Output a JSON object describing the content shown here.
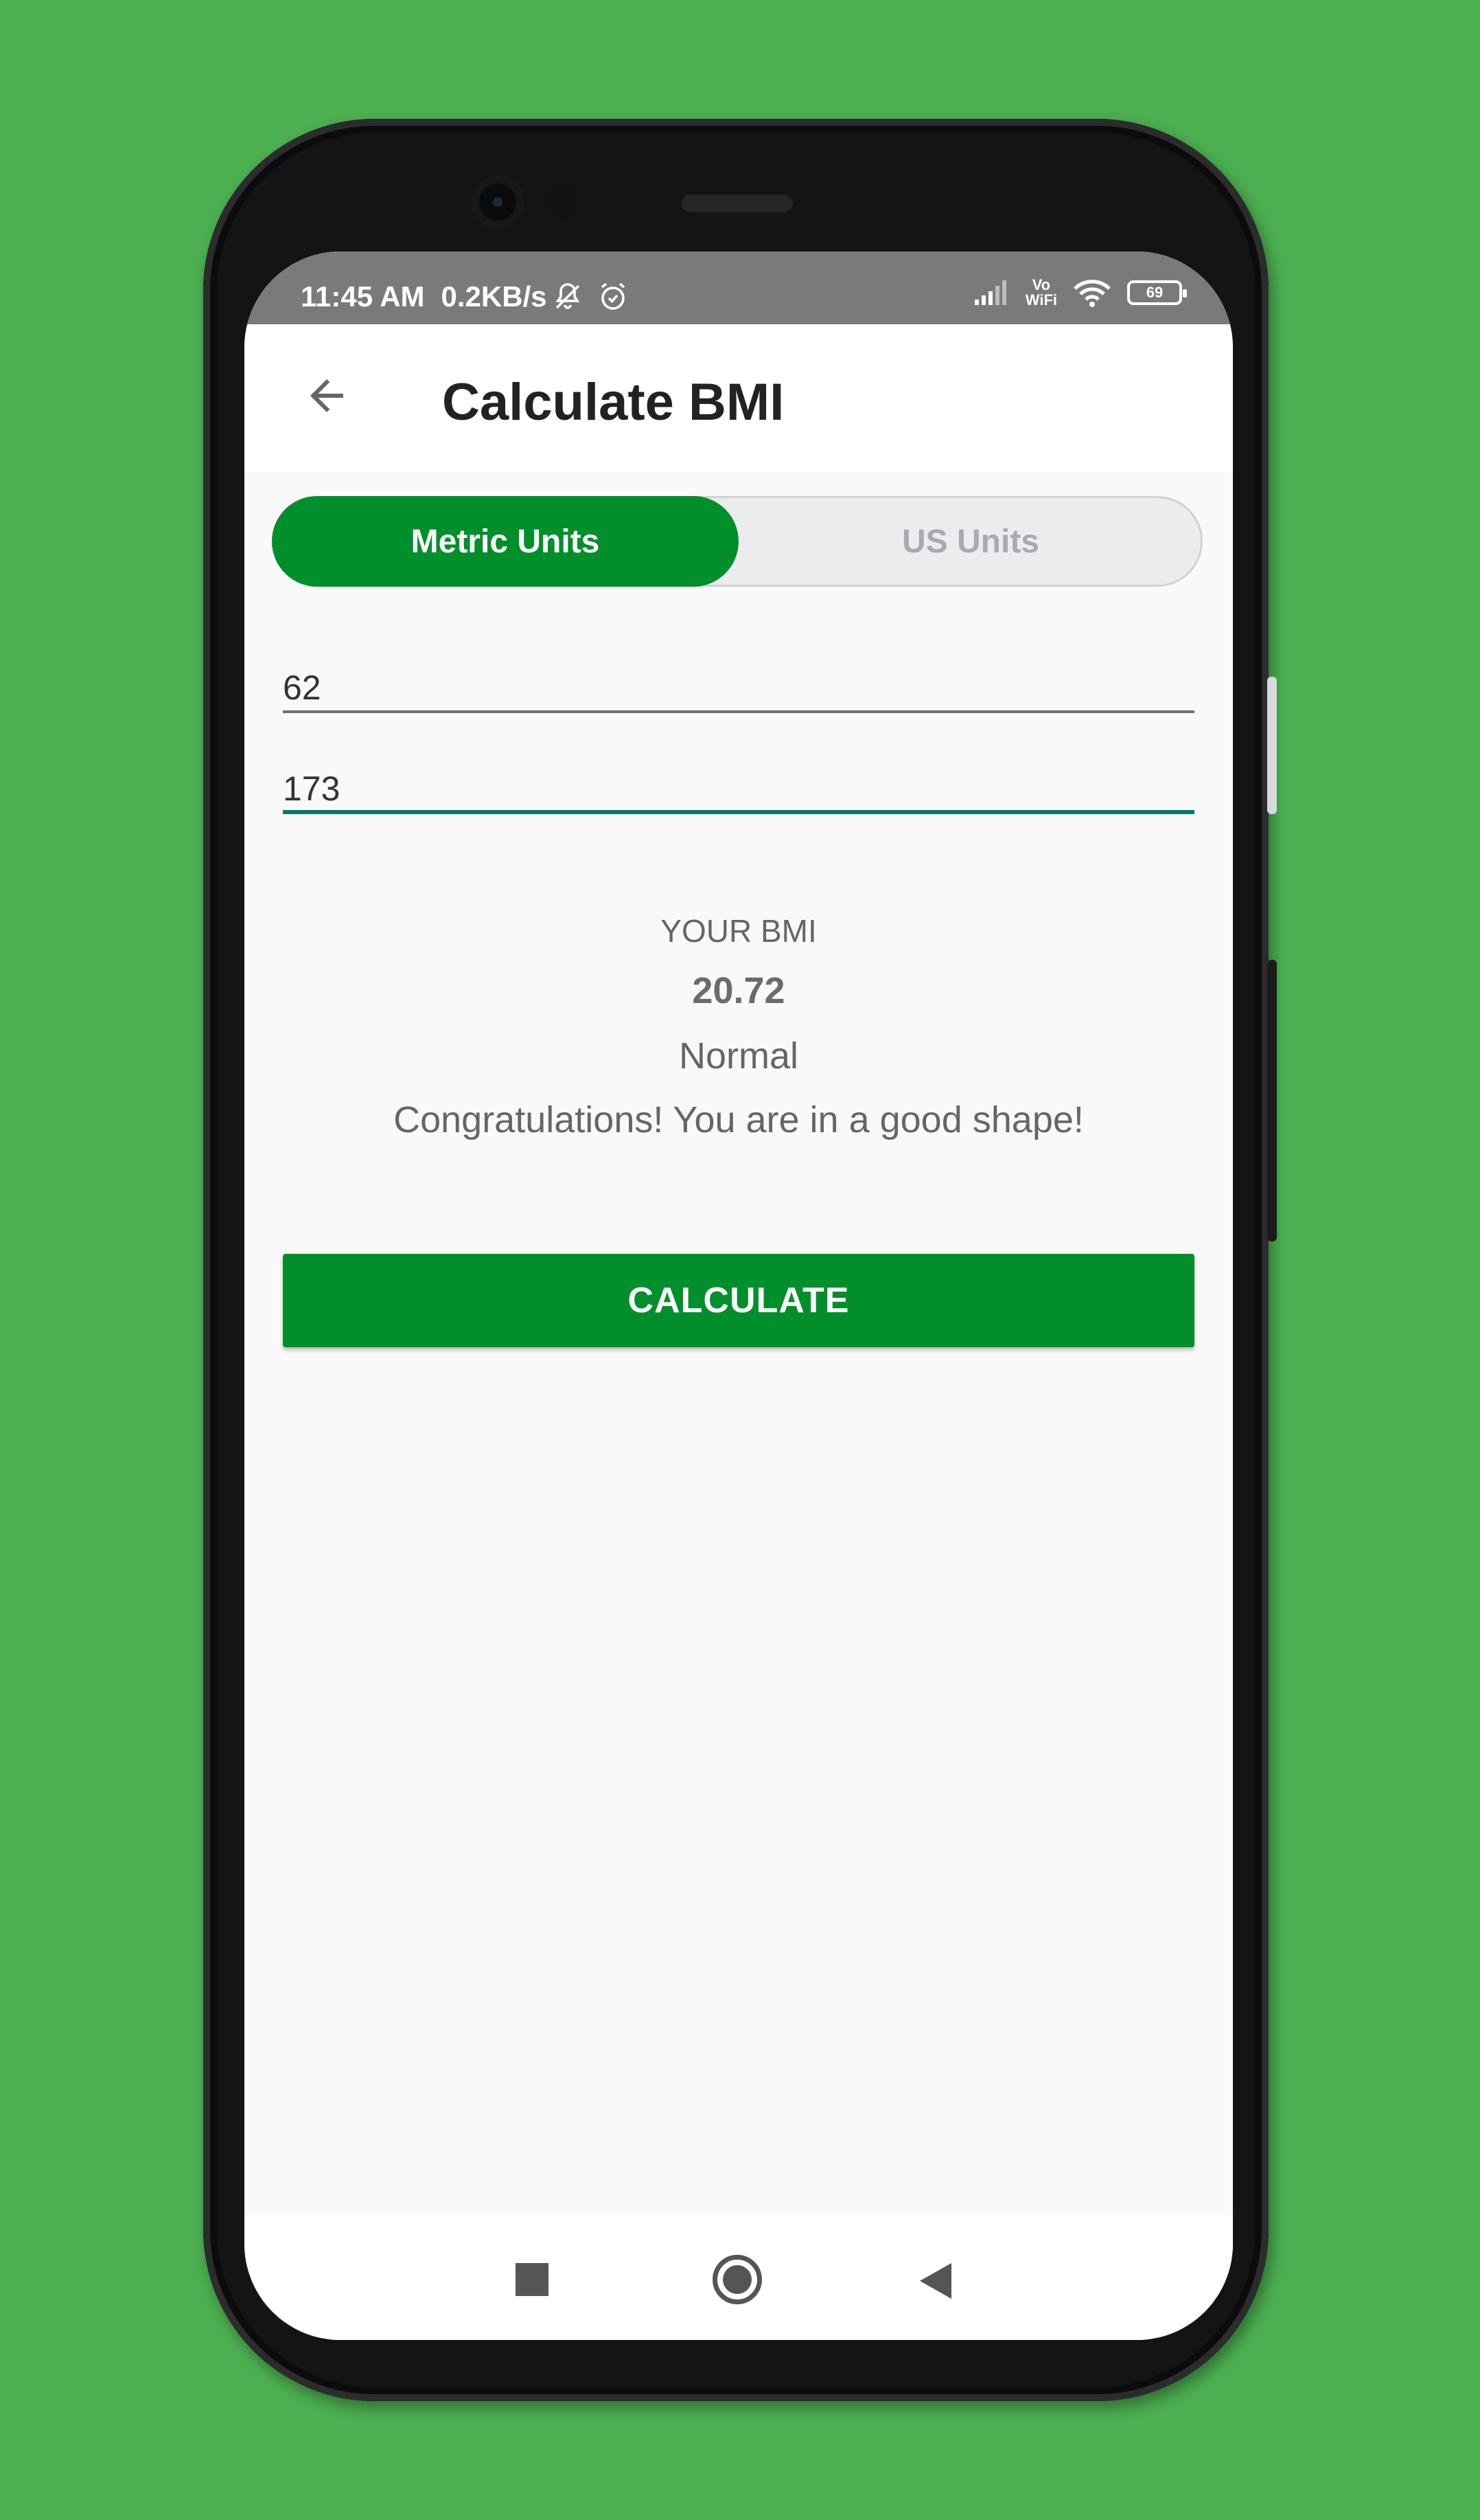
{
  "status_bar": {
    "time": "11:45 AM",
    "network_speed": "0.2KB/s",
    "icons": [
      "mute-icon",
      "alarm-icon",
      "signal-icon",
      "volte-icon",
      "wifi-icon",
      "battery-icon"
    ],
    "volte_top": "Vo",
    "volte_bottom": "WiFi",
    "battery_level": "69"
  },
  "app_bar": {
    "title": "Calculate BMI",
    "back_icon": "arrow-back-icon"
  },
  "unit_toggle": {
    "options": [
      {
        "label": "Metric Units",
        "selected": true
      },
      {
        "label": "US Units",
        "selected": false
      }
    ]
  },
  "inputs": {
    "weight_value": "62",
    "height_value": "173"
  },
  "result": {
    "label": "YOUR BMI",
    "value": "20.72",
    "category": "Normal",
    "message": "Congratulations! You are in a good shape!"
  },
  "actions": {
    "calculate_label": "CALCULATE"
  },
  "nav_bar": {
    "icons": [
      "recents-icon",
      "home-icon",
      "back-icon"
    ]
  },
  "colors": {
    "background": "#4caf50",
    "primary": "#008f2a",
    "input_focus": "#00796b",
    "status_bar": "#7a7a7a"
  }
}
